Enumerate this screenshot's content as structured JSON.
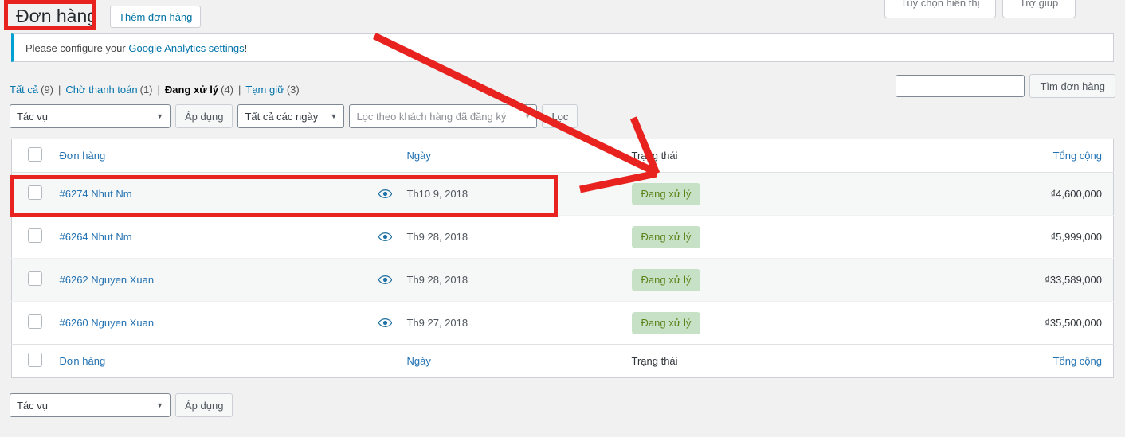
{
  "screen_meta": {
    "display_options_label": "Tùy chọn hiển thị",
    "help_label": "Trợ giúp"
  },
  "header": {
    "title": "Đơn hàng",
    "add_new_label": "Thêm đơn hàng"
  },
  "notice": {
    "text_before": "Please configure your ",
    "link_text": "Google Analytics settings",
    "text_after": "!"
  },
  "status_filters": {
    "items": [
      {
        "label": "Tất cả",
        "count": "(9)",
        "current": false
      },
      {
        "label": "Chờ thanh toán",
        "count": "(1)",
        "current": false
      },
      {
        "label": "Đang xử lý",
        "count": "(4)",
        "current": true
      },
      {
        "label": "Tạm giữ",
        "count": "(3)",
        "current": false
      }
    ],
    "separator": "|"
  },
  "search": {
    "value": "",
    "placeholder": "",
    "submit_label": "Tìm đơn hàng"
  },
  "tablenav_top": {
    "bulk_action_selected": "Tác vụ",
    "apply_label": "Áp dụng",
    "date_filter_selected": "Tất cả các ngày",
    "customer_filter_placeholder": "Lọc theo khách hàng đã đăng ký",
    "filter_label": "Lọc"
  },
  "tablenav_bottom": {
    "bulk_action_selected": "Tác vụ",
    "apply_label": "Áp dụng"
  },
  "table": {
    "columns": {
      "order": "Đơn hàng",
      "date": "Ngày",
      "status": "Trạng thái",
      "total": "Tổng cộng"
    },
    "rows": [
      {
        "order": "#6274 Nhut Nm",
        "date": "Th10 9, 2018",
        "status": "Đang xử lý",
        "total": "₫4,600,000",
        "preview_icon": "eye-icon"
      },
      {
        "order": "#6264 Nhut Nm",
        "date": "Th9 28, 2018",
        "status": "Đang xử lý",
        "total": "₫5,999,000",
        "preview_icon": "eye-icon"
      },
      {
        "order": "#6262 Nguyen Xuan",
        "date": "Th9 28, 2018",
        "status": "Đang xử lý",
        "total": "₫33,589,000",
        "preview_icon": "eye-icon"
      },
      {
        "order": "#6260 Nguyen Xuan",
        "date": "Th9 27, 2018",
        "status": "Đang xử lý",
        "total": "₫35,500,000",
        "preview_icon": "eye-icon"
      }
    ]
  },
  "colors": {
    "link": "#2271b1",
    "status_badge_bg": "#c6e1c6",
    "status_badge_text": "#5b841b",
    "annotation_red": "#e8231f",
    "notice_accent": "#00a0d2"
  }
}
